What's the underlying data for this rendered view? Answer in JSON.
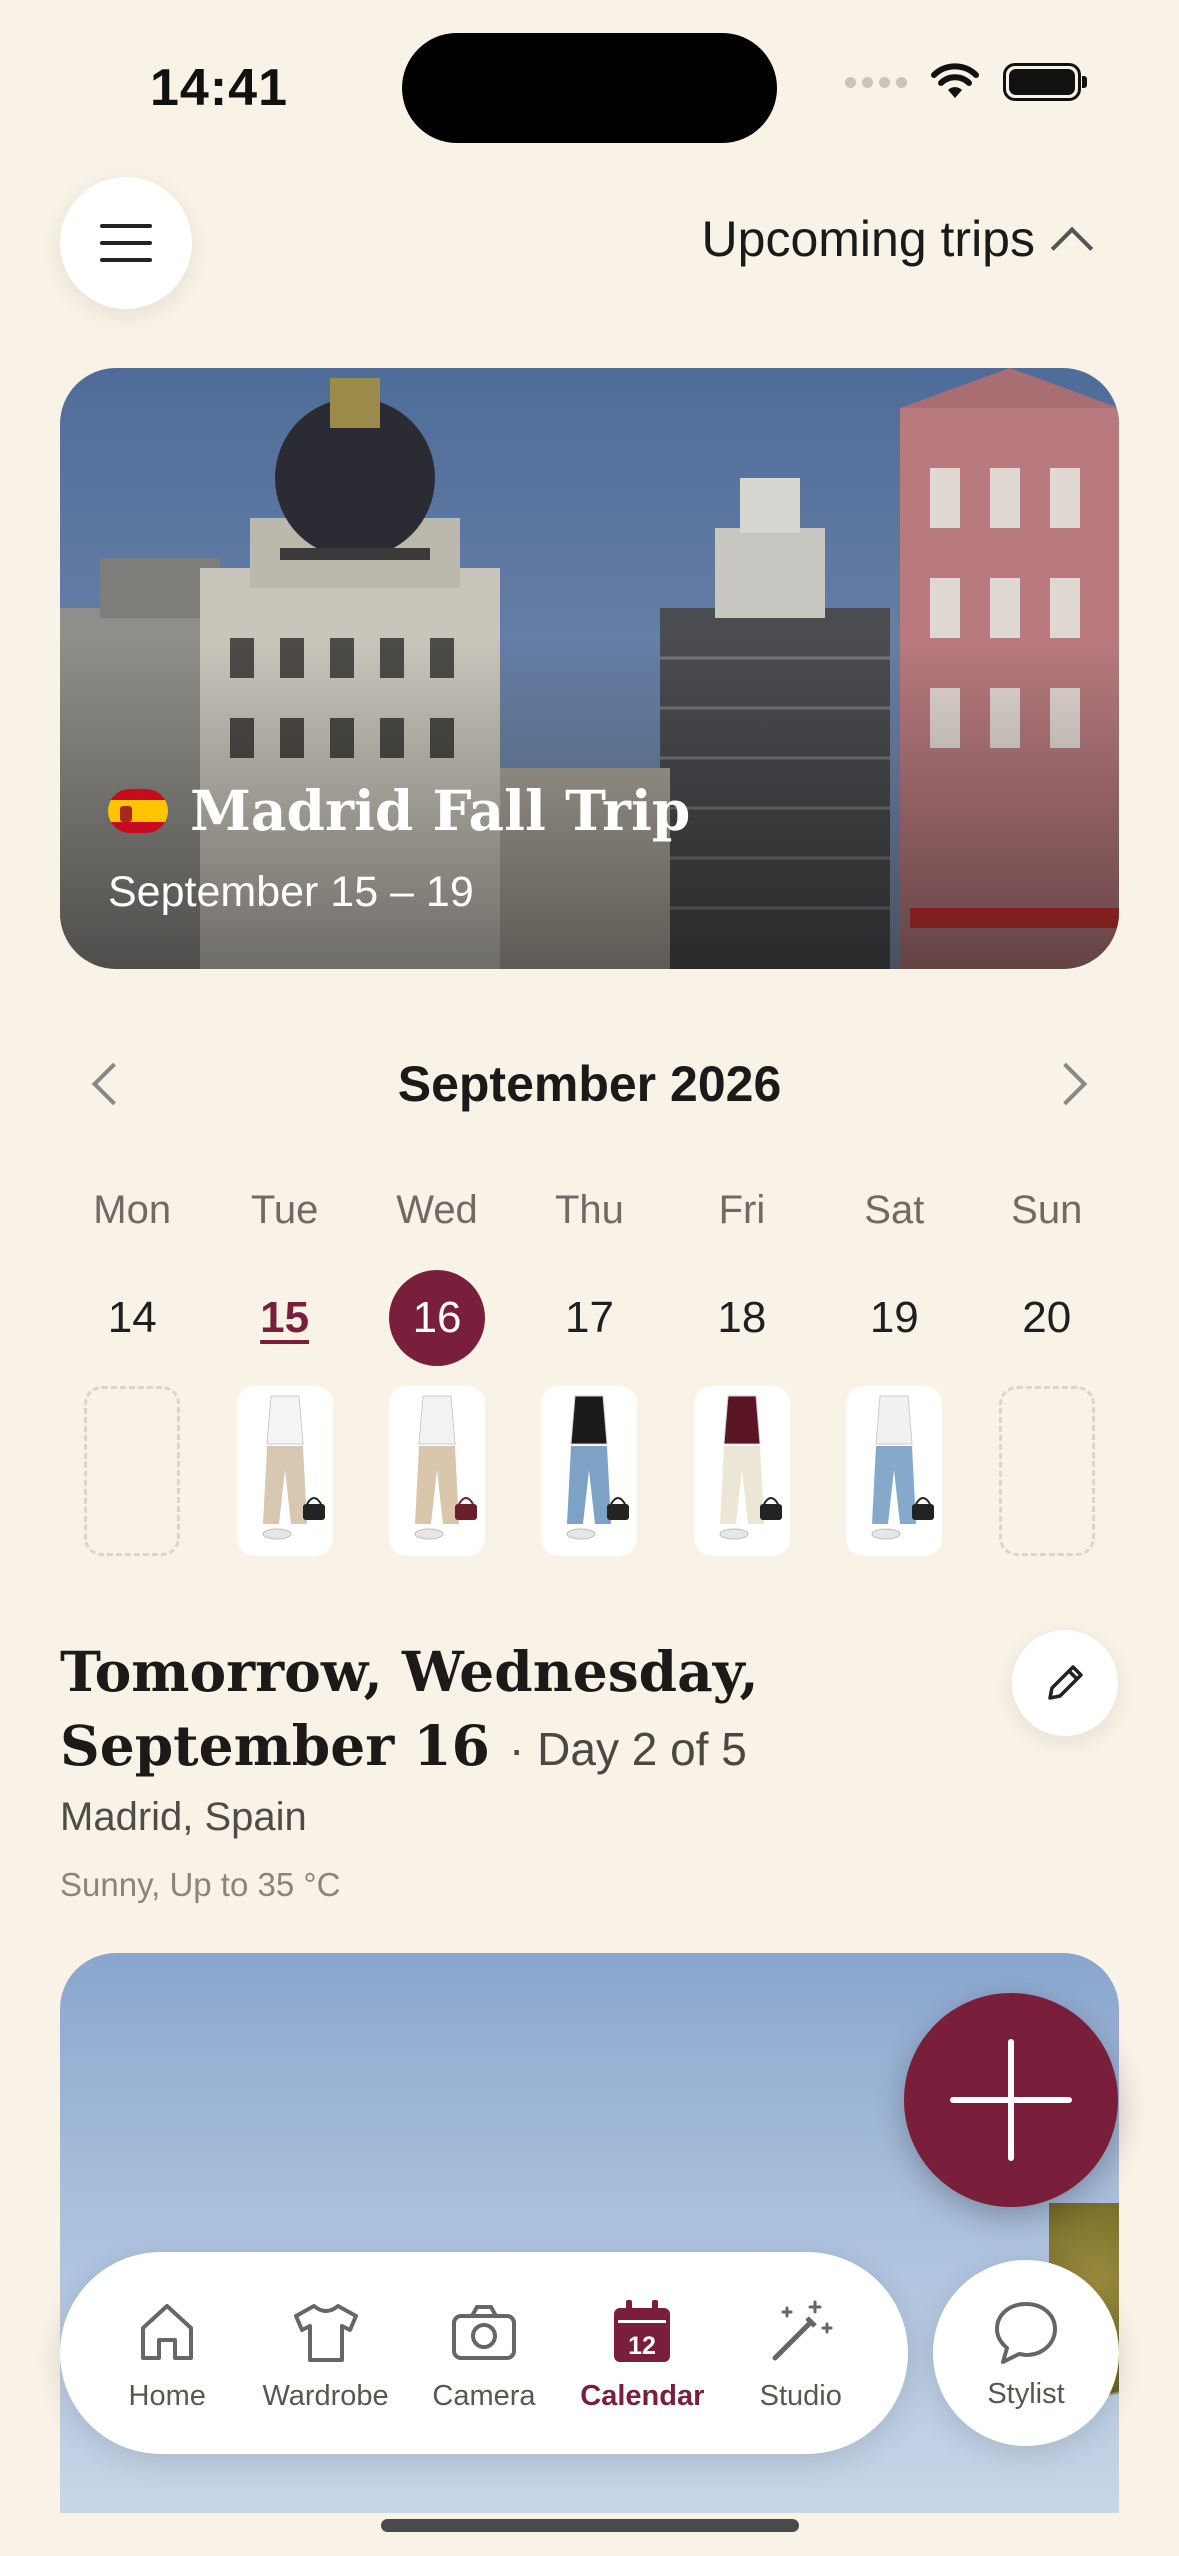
{
  "status_bar": {
    "time": "14:41"
  },
  "header": {
    "trips_toggle_label": "Upcoming trips"
  },
  "trip": {
    "title": "Madrid Fall Trip",
    "dates": "September 15 – 19",
    "country_flag": "spain-flag-icon"
  },
  "calendar": {
    "month_label": "September 2026",
    "days": [
      {
        "name": "Mon",
        "number": "14",
        "state": "normal",
        "outfit": false
      },
      {
        "name": "Tue",
        "number": "15",
        "state": "today",
        "outfit": true
      },
      {
        "name": "Wed",
        "number": "16",
        "state": "selected",
        "outfit": true
      },
      {
        "name": "Thu",
        "number": "17",
        "state": "normal",
        "outfit": true
      },
      {
        "name": "Fri",
        "number": "18",
        "state": "normal",
        "outfit": true
      },
      {
        "name": "Sat",
        "number": "19",
        "state": "normal",
        "outfit": true
      },
      {
        "name": "Sun",
        "number": "20",
        "state": "normal",
        "outfit": false
      }
    ]
  },
  "day_detail": {
    "heading": "Tomorrow, Wednesday, September 16",
    "day_count": "· Day 2 of 5",
    "location": "Madrid, Spain",
    "weather": "Sunny, Up to 35 °C"
  },
  "tabs": [
    {
      "label": "Home",
      "icon": "home-icon"
    },
    {
      "label": "Wardrobe",
      "icon": "tshirt-icon"
    },
    {
      "label": "Camera",
      "icon": "camera-icon"
    },
    {
      "label": "Calendar",
      "icon": "calendar-icon",
      "badge": "12",
      "active": true
    },
    {
      "label": "Studio",
      "icon": "magic-wand-icon"
    }
  ],
  "stylist": {
    "label": "Stylist",
    "icon": "chat-bubble-icon"
  },
  "colors": {
    "accent": "#7a1f3b",
    "background": "#f8f2e7"
  }
}
